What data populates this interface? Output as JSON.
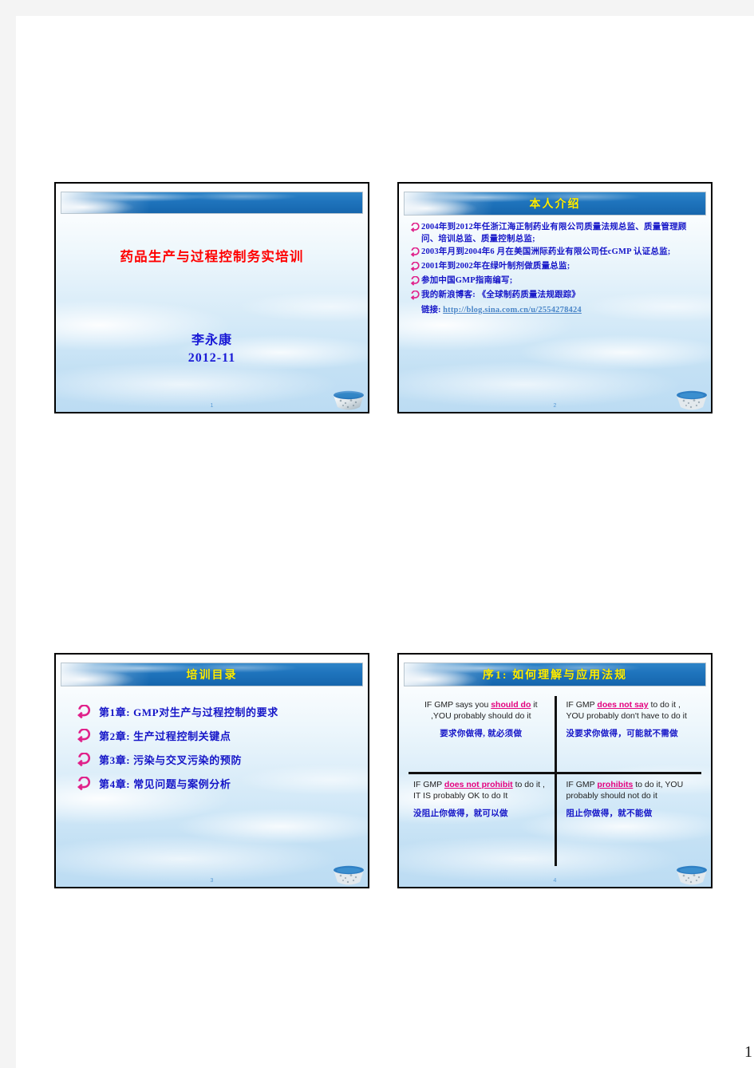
{
  "document": {
    "page_number": "1"
  },
  "slides": [
    {
      "number": "1",
      "title_cn": "药品生产与过程控制务实培训",
      "author": "李永康",
      "date": "2012-11"
    },
    {
      "number": "2",
      "band_title": "本人介绍",
      "bullets": [
        "2004年到2012年任浙江海正制药业有限公司质量法规总监、质量管理顾问、培训总监、质量控制总监;",
        "2003年月到2004年6 月在美国洲际药业有限公司任cGMP 认证总监;",
        "2001年到2002年在绿叶制剂做质量总监;",
        "参加中国GMP指南编写;",
        "我的新浪博客: 《全球制药质量法规跟踪》"
      ],
      "link_label": "链接:",
      "link_url": "http://blog.sina.com.cn/u/2554278424"
    },
    {
      "number": "3",
      "band_title": "培训目录",
      "bullets": [
        "第1章: GMP对生产与过程控制的要求",
        "第2章: 生产过程控制关键点",
        "第3章: 污染与交叉污染的预防",
        "第4章: 常见问题与案例分析"
      ]
    },
    {
      "number": "4",
      "band_title": "序1: 如何理解与应用法规",
      "quadrants": [
        {
          "en_pre": "IF GMP says you ",
          "en_hl": "should do",
          "en_post": " it ,YOU probably should do it",
          "cn": "要求你做得, 就必须做"
        },
        {
          "en_pre": " IF GMP ",
          "en_hl": "does not say",
          "en_post": " to do it , YOU probably don't have to do it",
          "cn": "没要求你做得，可能就不需做"
        },
        {
          "en_pre": " IF GMP ",
          "en_hl": "does not prohibit",
          "en_post": " to do it , IT IS probably OK to  do It",
          "cn": "没阻止你做得，就可以做"
        },
        {
          "en_pre": " IF GMP ",
          "en_hl": "prohibits",
          "en_post": " to do it,  YOU probably should not do it",
          "cn": "阻止你做得，就不能做"
        }
      ]
    }
  ],
  "colors": {
    "band_blue": "#1f74bd",
    "band_title_yellow": "#ffee00",
    "body_blue": "#1616c8",
    "title_red": "#ff0000",
    "highlight_pink": "#e4007f",
    "link_blue": "#4a86c8"
  }
}
